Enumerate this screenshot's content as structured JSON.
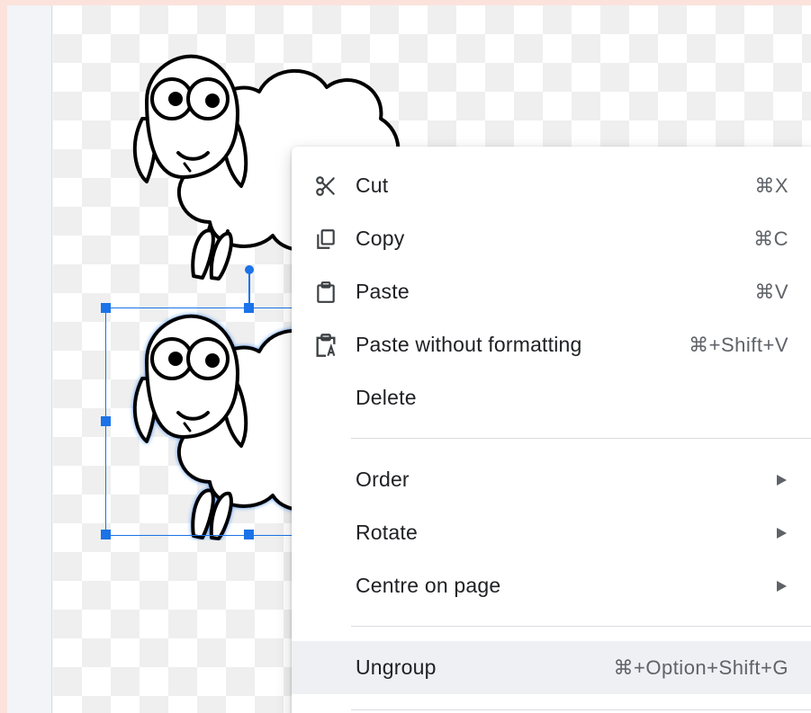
{
  "context_menu": {
    "items": [
      {
        "label": "Cut",
        "shortcut": "⌘X",
        "icon": "scissors-icon"
      },
      {
        "label": "Copy",
        "shortcut": "⌘C",
        "icon": "copy-icon"
      },
      {
        "label": "Paste",
        "shortcut": "⌘V",
        "icon": "clipboard-icon"
      },
      {
        "label": "Paste without formatting",
        "shortcut": "⌘+Shift+V",
        "icon": "paste-plain-icon"
      },
      {
        "label": "Delete",
        "shortcut": ""
      },
      {
        "label": "Order",
        "submenu": true
      },
      {
        "label": "Rotate",
        "submenu": true
      },
      {
        "label": "Centre on page",
        "submenu": true
      },
      {
        "label": "Ungroup",
        "shortcut": "⌘+Option+Shift+G",
        "highlighted": true
      }
    ]
  },
  "colors": {
    "selection": "#1a73e8",
    "menu_text": "#202124",
    "shortcut_text": "#5f6368",
    "highlight": "#eef0f3"
  }
}
